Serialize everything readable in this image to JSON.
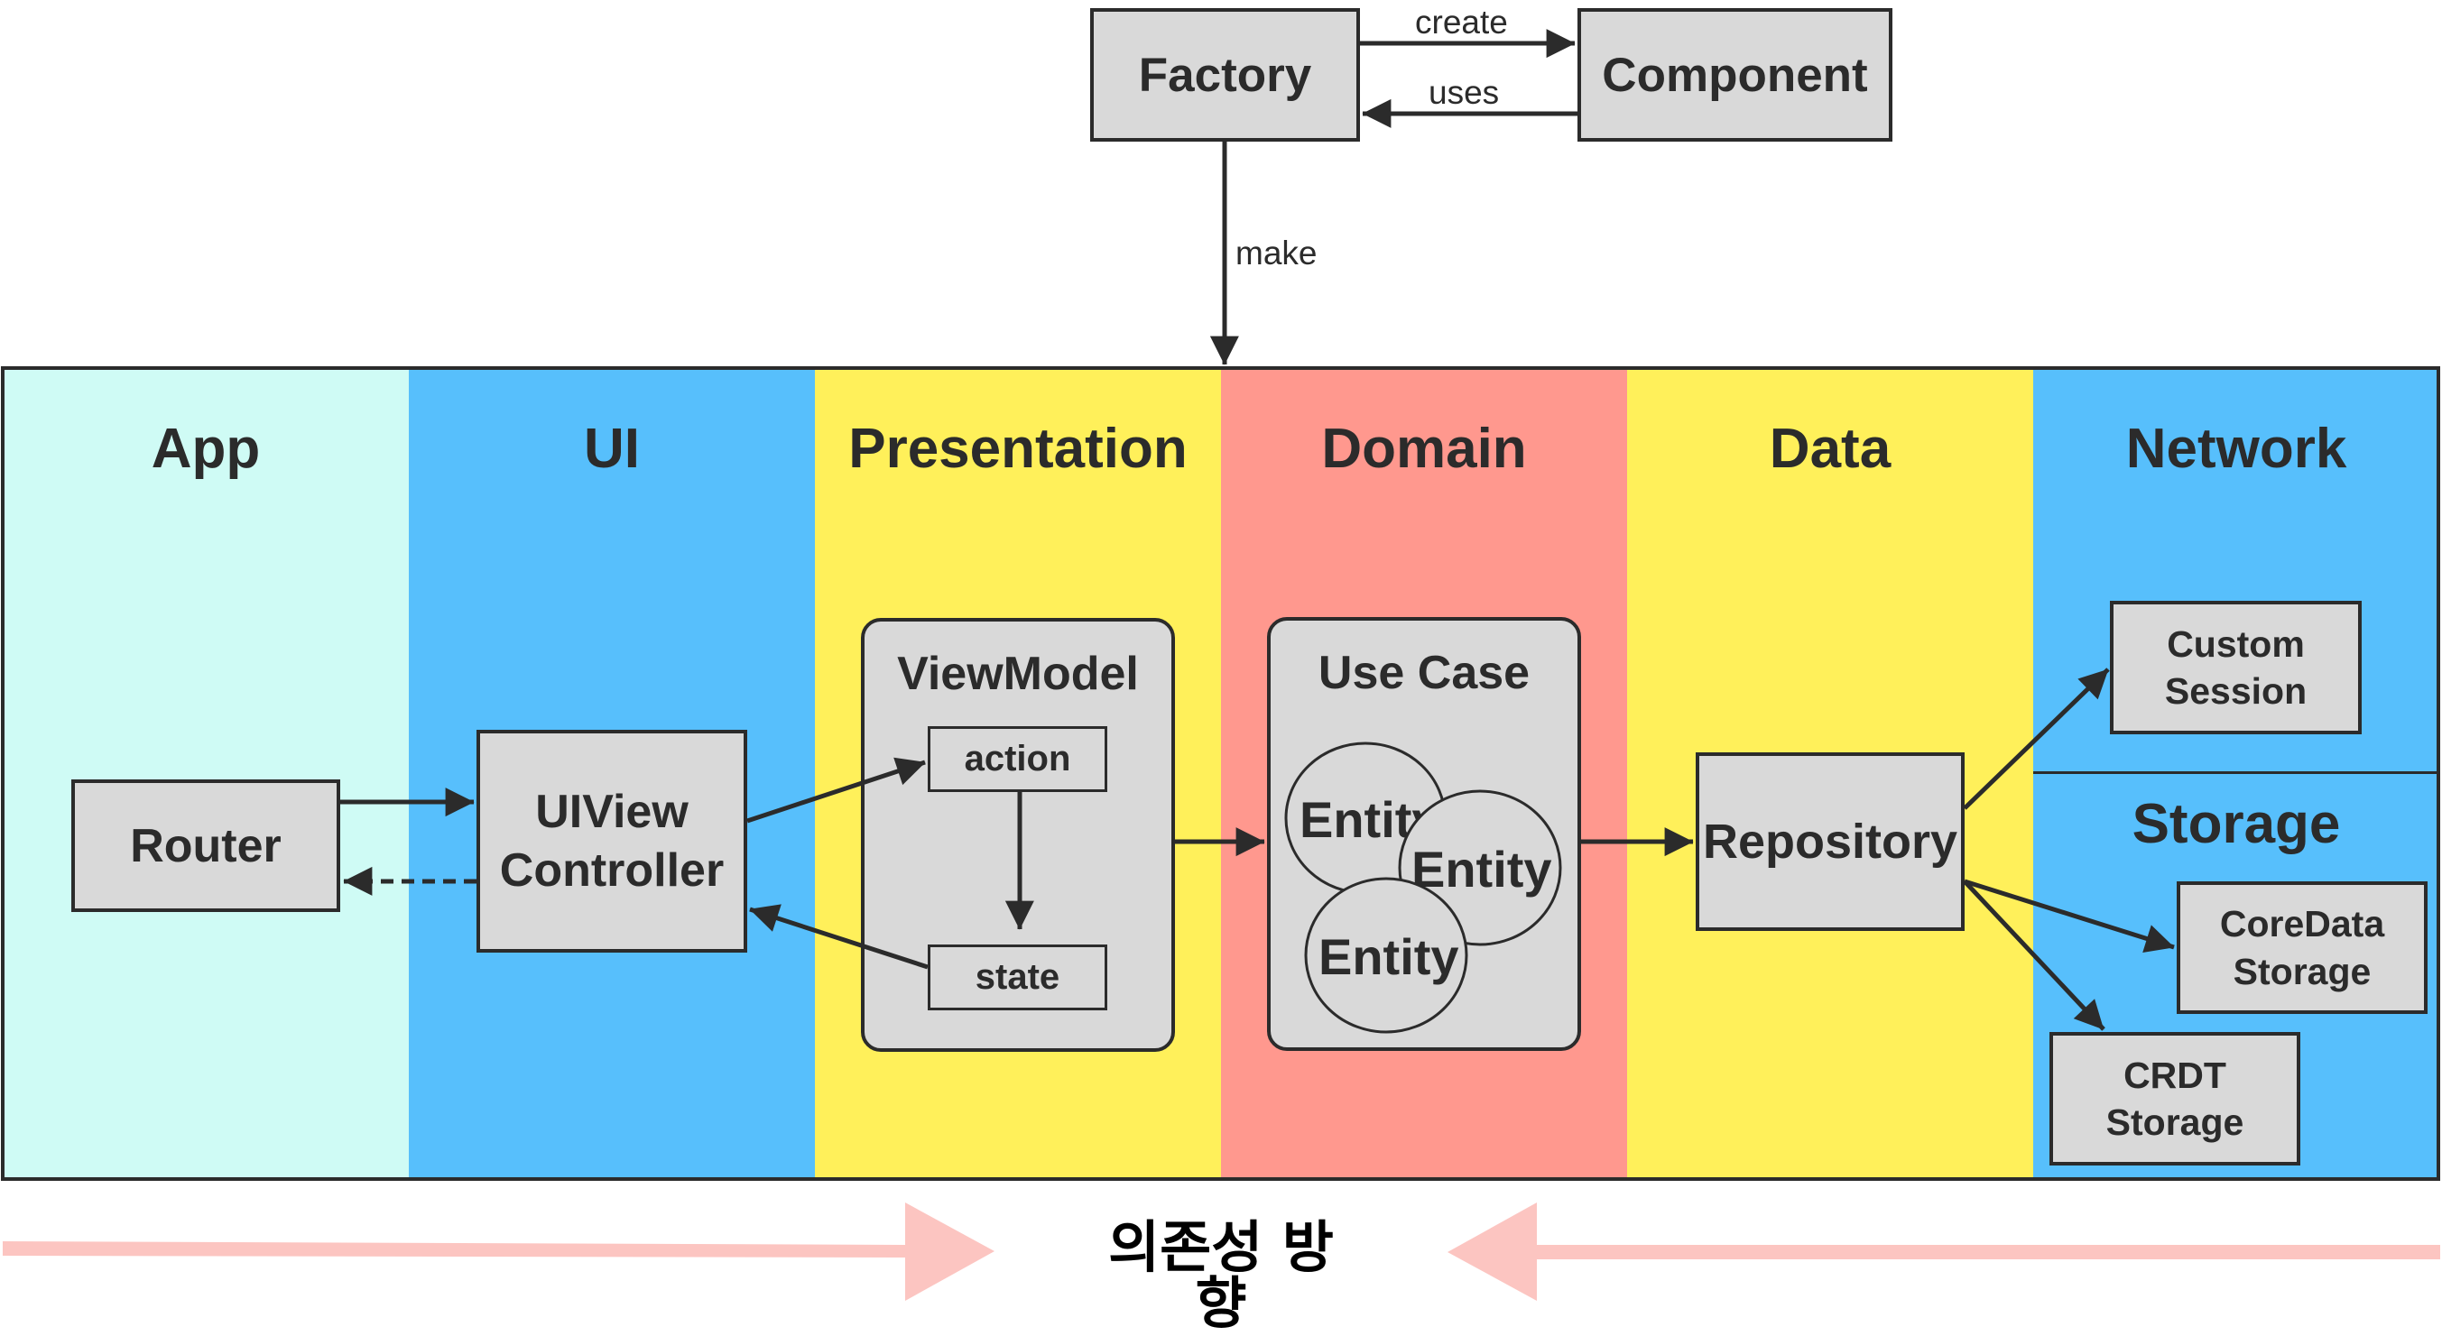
{
  "top": {
    "factory": "Factory",
    "component": "Component",
    "create_label": "create",
    "uses_label": "uses",
    "make_label": "make"
  },
  "layers": [
    {
      "name": "App",
      "color": "#cffbf5"
    },
    {
      "name": "UI",
      "color": "#57bffc"
    },
    {
      "name": "Presentation",
      "color": "#fff05a"
    },
    {
      "name": "Domain",
      "color": "#ff988e"
    },
    {
      "name": "Data",
      "color": "#fff05a"
    },
    {
      "name": "Network",
      "color": "#57bffc"
    }
  ],
  "app": {
    "router": "Router"
  },
  "ui": {
    "controller_line1": "UIView",
    "controller_line2": "Controller"
  },
  "presentation": {
    "viewmodel": "ViewModel",
    "action": "action",
    "state": "state"
  },
  "domain": {
    "usecase": "Use Case",
    "entities": [
      "Entity",
      "Entity",
      "Entity"
    ]
  },
  "data": {
    "repository": "Repository"
  },
  "network": {
    "custom_session_line1": "Custom",
    "custom_session_line2": "Session"
  },
  "storage": {
    "title": "Storage",
    "coredata_line1": "CoreData",
    "coredata_line2": "Storage",
    "crdt_line1": "CRDT",
    "crdt_line2": "Storage"
  },
  "footer": {
    "dependency_direction": "의존성 방향",
    "arrow_color": "#fcc5c1"
  },
  "colors": {
    "box_fill": "#d9d9d9",
    "stroke": "#2b2b2b"
  }
}
